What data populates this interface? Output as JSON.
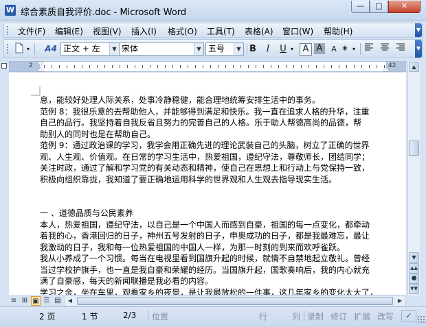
{
  "window": {
    "title": "综合素质自我评价.doc - Microsoft Word",
    "app_icon_letter": "W",
    "minimize_glyph": "—",
    "maximize_glyph": "□",
    "close_glyph": "✕"
  },
  "menu": {
    "items": [
      "文件(F)",
      "编辑(E)",
      "视图(V)",
      "插入(I)",
      "格式(O)",
      "工具(T)",
      "表格(A)",
      "窗口(W)",
      "帮助(H)"
    ]
  },
  "toolbar": {
    "style_value": "正文 + 左",
    "font_value": "宋体",
    "size_value": "五号",
    "bold": "B",
    "italic": "I",
    "underline": "U",
    "highlight": "A",
    "char_shading": "A",
    "char_scale": "A",
    "styles_icon": "A4"
  },
  "ruler": {
    "label_left": "2",
    "label_right": "42"
  },
  "document": {
    "lines": [
      "息，能较好处理人际关系，处事冷静稳健，能合理地统筹安排生活中的事务。",
      "范例 8：我很乐意的去帮助他人，并能够得到满足和快乐。我一直在追求人格的升华，注重",
      "自己的品行。我坚持着自我反省且努力的完善自己的人格。乐于助人帮德高尚的品德，帮",
      "助别人的同时也是在帮助自己。",
      "范例 9：通过政治课的学习，我学会用正确先进的理论武装自己的头脑，树立了正确的世界",
      "观、人生观、价值观。在日常的学习生活中，热爱祖国，遵纪守法，尊敬师长，团结同学；",
      "关注时政，通过了解和学习党的有关动态和精神，使自己在思想上和行动上与党保持一致，",
      "积极向组织靠拢，我知道了要正确地运用科学的世界观和人生观去指导现实生活。",
      "",
      "",
      "一 、道德品质与公民素养",
      "本人，热爱祖国，遵纪守法，以自己是一个中国人而感到自豪，祖国的每一点变化，都牵动",
      "着我的心，香港回归的日子，神州五号发射的日子，申奥成功的日子，都是我最难忘，最让",
      "我激动的日子，我和每一位热爱祖国的中国人一样，为那一时刻的到来而欢呼雀跃。",
      "我从小养成了一个习惯。每当在电视里看到国旗升起的时候，就情不自禁地起立敬礼。曾经",
      "当过学校护旗手，也一直是我自豪和荣耀的经历。当国旗升起，国歌奏响后，我的内心就充",
      "满了自豪感，每天的新闻联播是我必看的内容。",
      "学习之余，坐在车里，观看家乡的夜景，是让我最放松的一件事，这几年家乡的变化太大了，"
    ]
  },
  "statusbar": {
    "page": "2 页",
    "section": "1 节",
    "page_of": "2/3",
    "position": "位置",
    "line": "行",
    "column": "列",
    "rec": "录制",
    "trk": "修订",
    "ext": "扩展",
    "ovr": "改写"
  }
}
